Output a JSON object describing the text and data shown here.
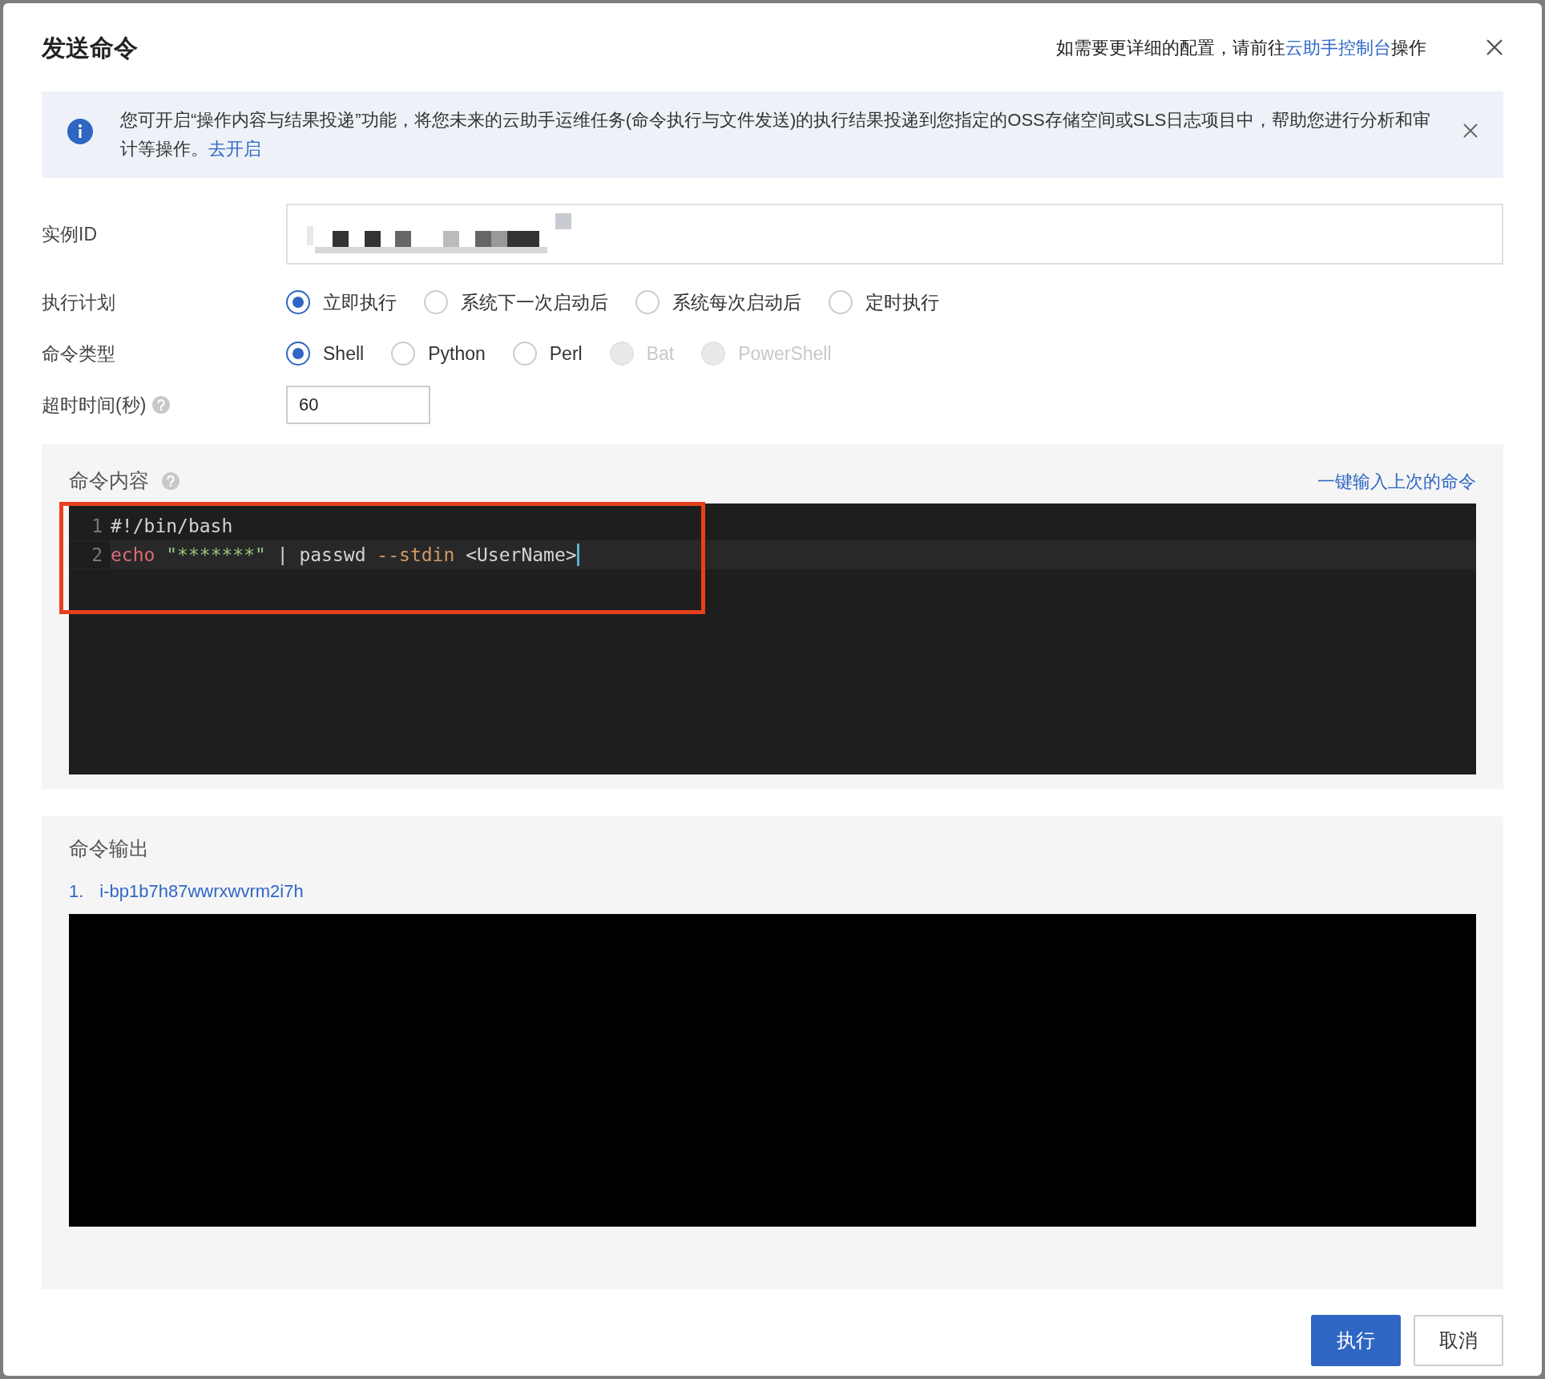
{
  "dialog": {
    "title": "发送命令",
    "hint": "如需要更详细的配置，请前往",
    "hint_link": "云助手控制台",
    "hint_suffix": "操作"
  },
  "notice": {
    "text": "您可开启“操作内容与结果投递”功能，将您未来的云助手运维任务(命令执行与文件发送)的执行结果投递到您指定的OSS存储空间或SLS日志项目中，帮助您进行分析和审计等操作。",
    "link": "去开启"
  },
  "form": {
    "instance_id_label": "实例ID",
    "schedule": {
      "label": "执行计划",
      "options": [
        {
          "label": "立即执行",
          "selected": true,
          "disabled": false
        },
        {
          "label": "系统下一次启动后",
          "selected": false,
          "disabled": false
        },
        {
          "label": "系统每次启动后",
          "selected": false,
          "disabled": false
        },
        {
          "label": "定时执行",
          "selected": false,
          "disabled": false
        }
      ]
    },
    "command_type": {
      "label": "命令类型",
      "options": [
        {
          "label": "Shell",
          "selected": true,
          "disabled": false
        },
        {
          "label": "Python",
          "selected": false,
          "disabled": false
        },
        {
          "label": "Perl",
          "selected": false,
          "disabled": false
        },
        {
          "label": "Bat",
          "selected": false,
          "disabled": true
        },
        {
          "label": "PowerShell",
          "selected": false,
          "disabled": true
        }
      ]
    },
    "timeout": {
      "label": "超时时间(秒)",
      "value": "60"
    }
  },
  "command": {
    "title": "命令内容",
    "fill_last": "一键输入上次的命令",
    "lines": [
      {
        "number": "1",
        "active": false,
        "tokens": [
          {
            "kind": "plain",
            "text": "#!/bin/bash"
          }
        ]
      },
      {
        "number": "2",
        "active": true,
        "tokens": [
          {
            "kind": "keyword",
            "text": "echo "
          },
          {
            "kind": "string",
            "text": "\"*******\""
          },
          {
            "kind": "plain",
            "text": " | passwd "
          },
          {
            "kind": "option",
            "text": "--stdin"
          },
          {
            "kind": "plain",
            "text": " <UserName>"
          }
        ]
      }
    ]
  },
  "output": {
    "title": "命令输出",
    "instances": [
      {
        "number": "1.",
        "id": "i-bp1b7h87wwrxwvrm2i7h"
      }
    ]
  },
  "buttons": [
    {
      "label": "执行",
      "kind": "primary"
    },
    {
      "label": "取消",
      "kind": "secondary"
    }
  ]
}
